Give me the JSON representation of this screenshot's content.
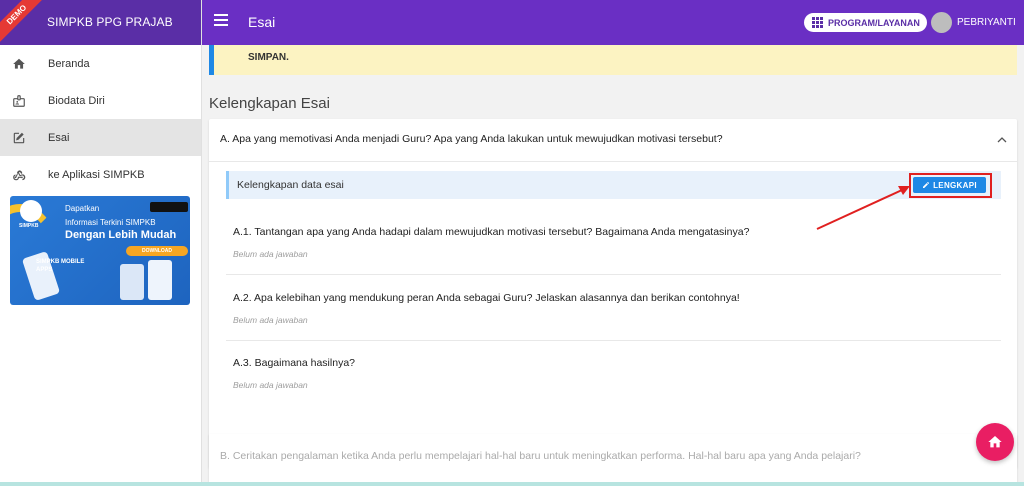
{
  "sidebar": {
    "demo_ribbon": "DEMO",
    "app_title": "SIMPKB PPG PRAJAB",
    "items": [
      {
        "label": "Beranda",
        "icon": "home-icon"
      },
      {
        "label": "Biodata Diri",
        "icon": "id-card-icon"
      },
      {
        "label": "Esai",
        "icon": "edit-icon"
      },
      {
        "label": "ke Aplikasi SIMPKB",
        "icon": "webhook-icon"
      }
    ],
    "promo": {
      "line1": "Dapatkan",
      "line2": "Informasi Terkini SIMPKB",
      "line3": "Dengan Lebih Mudah",
      "download": "DOWNLOAD",
      "apps": "SIMPKB MOBILE APPS",
      "logo_text": "SIMPKB"
    }
  },
  "topbar": {
    "title": "Esai",
    "program_label": "PROGRAM/LAYANAN",
    "user_name": "PEBRIYANTI"
  },
  "main": {
    "alert_tail": "SIMPAN.",
    "section_title": "Kelengkapan Esai",
    "card_a": {
      "question": "A. Apa yang memotivasi Anda menjadi Guru? Apa yang Anda lakukan untuk mewujudkan motivasi tersebut?",
      "kelengkapan_label": "Kelengkapan data esai",
      "lengkapi_button": "LENGKAPI",
      "subs": [
        {
          "q": "A.1. Tantangan apa yang Anda hadapi dalam mewujudkan motivasi tersebut? Bagaimana Anda mengatasinya?",
          "answer": "Belum ada jawaban"
        },
        {
          "q": "A.2. Apa kelebihan yang mendukung peran Anda sebagai Guru? Jelaskan alasannya dan berikan contohnya!",
          "answer": "Belum ada jawaban"
        },
        {
          "q": "A.3. Bagaimana hasilnya?",
          "answer": "Belum ada jawaban"
        }
      ]
    },
    "card_b": {
      "question": "B. Ceritakan pengalaman ketika Anda perlu mempelajari hal-hal baru untuk meningkatkan performa. Hal-hal baru apa yang Anda pelajari?"
    }
  },
  "colors": {
    "topbar": "#6a2fc4",
    "accent": "#1e88e5",
    "highlight": "#e02020",
    "fab": "#e91e63"
  }
}
